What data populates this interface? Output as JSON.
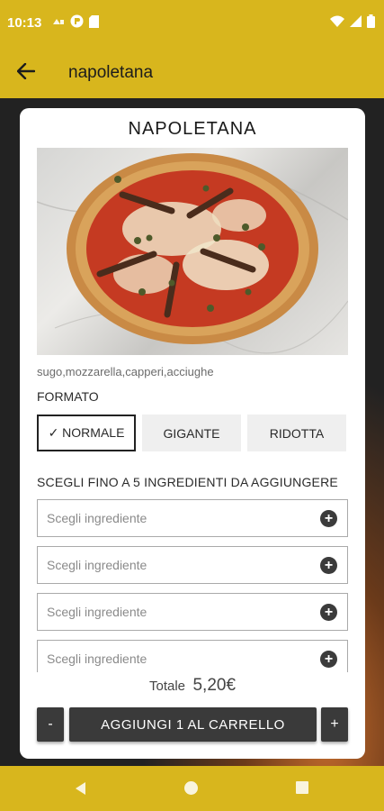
{
  "status_bar": {
    "time": "10:13",
    "left_icons": [
      "sim-icon",
      "app-notification-icon",
      "sd-card-icon"
    ],
    "right_icons": [
      "wifi-icon",
      "signal-icon",
      "battery-icon"
    ]
  },
  "app_bar": {
    "back_icon": "arrow-left-icon",
    "title": "napoletana"
  },
  "product": {
    "name": "NAPOLETANA",
    "image": "pizza-image",
    "ingredients": "sugo,mozzarella,capperi,acciughe"
  },
  "format": {
    "label": "FORMATO",
    "options": [
      {
        "label": "✓ NORMALE",
        "selected": true
      },
      {
        "label": "GIGANTE",
        "selected": false
      },
      {
        "label": "RIDOTTA",
        "selected": false
      }
    ]
  },
  "extras": {
    "label": "SCEGLI FINO A 5 INGREDIENTI DA AGGIUNGERE",
    "slots": [
      {
        "placeholder": "Scegli ingrediente"
      },
      {
        "placeholder": "Scegli ingrediente"
      },
      {
        "placeholder": "Scegli ingrediente"
      },
      {
        "placeholder": "Scegli ingrediente"
      }
    ],
    "add_icon": "plus-circle-icon"
  },
  "cart": {
    "total_label": "Totale",
    "total_value": "5,20€",
    "minus_label": "-",
    "add_label": "AGGIUNGI 1 AL CARRELLO",
    "plus_label": "+",
    "quantity": 1
  },
  "nav_bar": {
    "icons": [
      "nav-back-icon",
      "nav-home-icon",
      "nav-recents-icon"
    ]
  },
  "colors": {
    "brand_yellow": "#d8b61d",
    "button_dark": "#3a3a3a",
    "card_bg": "#ffffff"
  }
}
